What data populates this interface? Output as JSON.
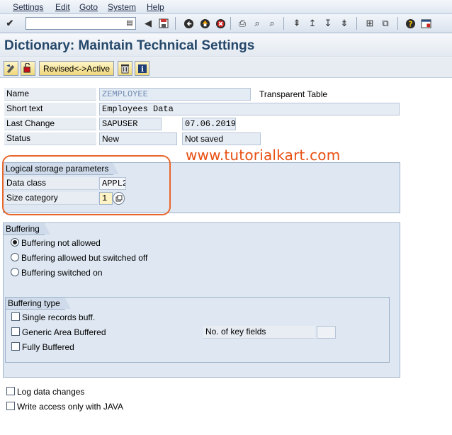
{
  "menu": [
    "Settings",
    "Edit",
    "Goto",
    "System",
    "Help"
  ],
  "toolbar": {
    "command_value": "",
    "icons": [
      "enter-icon",
      "back-icon",
      "save-icon",
      "back-nav-icon",
      "exit-icon",
      "cancel-icon",
      "print-icon",
      "find-icon",
      "find-next-icon",
      "first-page-icon",
      "prev-page-icon",
      "next-page-icon",
      "last-page-icon",
      "create-session-icon",
      "shortcut-icon",
      "help-icon",
      "customize-layout-icon"
    ]
  },
  "title": "Dictionary: Maintain Technical Settings",
  "app_toolbar": {
    "revised_active_label": "Revised<->Active"
  },
  "fields": {
    "name_label": "Name",
    "name_value": "ZEMPLOYEE",
    "table_type": "Transparent Table",
    "short_text_label": "Short text",
    "short_text_value": "Employees Data",
    "last_change_label": "Last Change",
    "last_change_user": "SAPUSER",
    "last_change_date": "07.06.2019",
    "status_label": "Status",
    "status_value": "New",
    "status_saved": "Not saved"
  },
  "logical_storage": {
    "title": "Logical storage parameters",
    "data_class_label": "Data class",
    "data_class_value": "APPL2",
    "size_category_label": "Size category",
    "size_category_value": "1"
  },
  "buffering": {
    "title": "Buffering",
    "options": [
      "Buffering not allowed",
      "Buffering allowed but switched off",
      "Buffering switched on"
    ],
    "selected_index": 0
  },
  "buffering_type": {
    "title": "Buffering type",
    "options": [
      "Single records buff.",
      "Generic Area Buffered",
      "Fully Buffered"
    ],
    "key_fields_label": "No. of key fields",
    "key_fields_value": ""
  },
  "footer_checks": [
    "Log data changes",
    "Write access only with JAVA"
  ],
  "watermark": "www.tutorialkart.com"
}
